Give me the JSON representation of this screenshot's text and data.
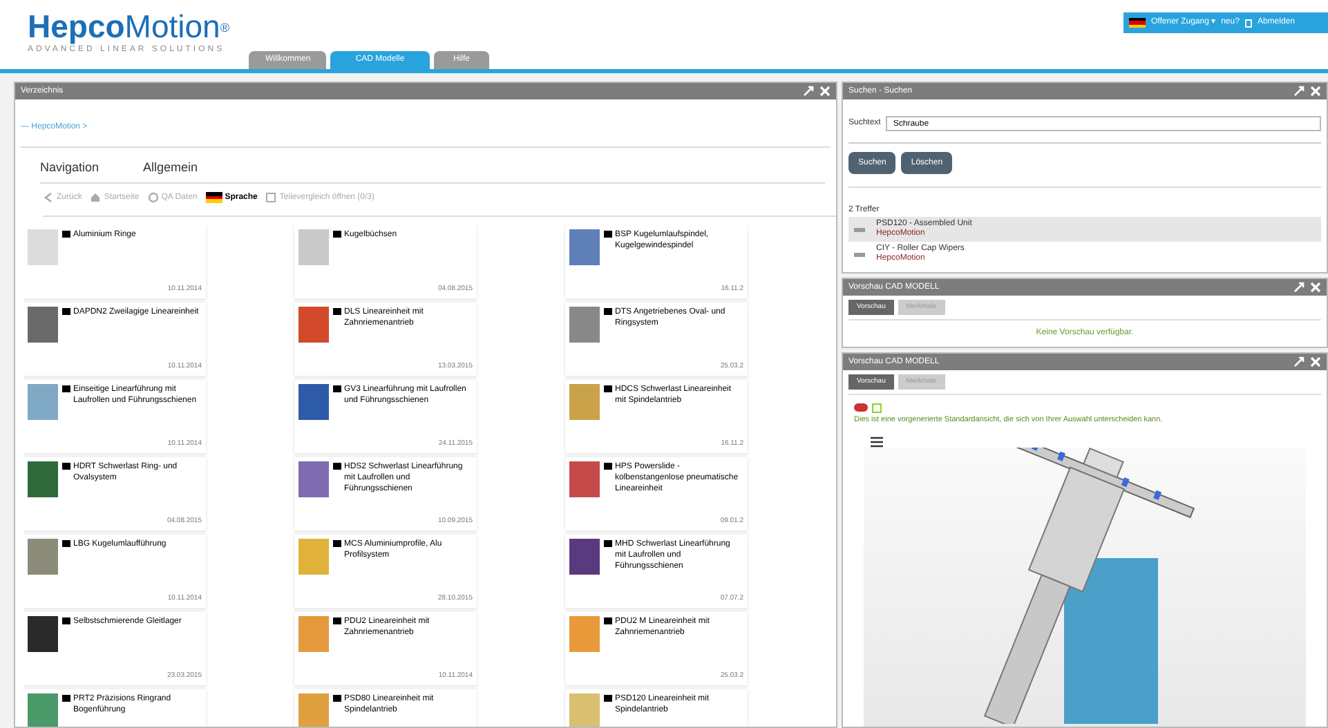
{
  "header": {
    "logo": {
      "name_bold": "Hepco",
      "name_light": "Motion",
      "mark": "®",
      "tagline": "ADVANCED LINEAR SOLUTIONS"
    },
    "tabs": [
      {
        "label": "Willkommen",
        "selected": false
      },
      {
        "label": "CAD Modelle",
        "selected": true
      },
      {
        "label": "Hilfe",
        "selected": false
      }
    ],
    "user_bar": {
      "access": "Offener Zugang",
      "caret": "▾",
      "links": [
        "neu?",
        "Abmelden"
      ]
    }
  },
  "catalog_panel": {
    "title": "Verzeichnis",
    "breadcrumb": "— HepcoMotion >",
    "nav_tabs": [
      "Navigation",
      "Allgemein"
    ],
    "toolbar": [
      {
        "kind": "back",
        "label": "Zurück"
      },
      {
        "kind": "home",
        "label": "Startseite"
      },
      {
        "kind": "qa",
        "label": "QA Daten"
      },
      {
        "kind": "language",
        "label": "Sprache"
      },
      {
        "kind": "compare",
        "label": "Teilevergleich öffnen (0/3)"
      }
    ],
    "items": [
      {
        "title": "Aluminium Ringe",
        "date": "10.11.2014"
      },
      {
        "title": "Kugelbüchsen",
        "date": "04.08.2015"
      },
      {
        "title": "BSP Kugelumlaufspindel, Kugelgewindespindel",
        "date": "16.11.2"
      },
      {
        "title": "DAPDN2 Zweilagige Lineareinheit",
        "date": "10.11.2014"
      },
      {
        "title": "DLS Lineareinheit mit Zahnriemenantrieb",
        "date": "13.03.2015"
      },
      {
        "title": "DTS Angetriebenes Oval- und Ringsystem",
        "date": "25.03.2"
      },
      {
        "title": "Einseitige Linearführung mit Laufrollen und Führungsschienen",
        "date": "10.11.2014"
      },
      {
        "title": "GV3 Linearführung mit Laufrollen und Führungsschienen",
        "date": "24.11.2015"
      },
      {
        "title": "HDCS Schwerlast Lineareinheit mit Spindelantrieb",
        "date": "16.11.2"
      },
      {
        "title": "HDRT Schwerlast Ring- und Ovalsystem",
        "date": "04.08.2015"
      },
      {
        "title": "HDS2 Schwerlast Linearführung mit Laufrollen und Führungsschienen",
        "date": "10.09.2015"
      },
      {
        "title": "HPS Powerslide - kolbenstangenlose pneumatische Lineareinheit",
        "date": "09.01.2"
      },
      {
        "title": "LBG Kugelumlaufführung",
        "date": "10.11.2014"
      },
      {
        "title": "MCS Aluminiumprofile, Alu Profilsystem",
        "date": "28.10.2015"
      },
      {
        "title": "MHD Schwerlast Linearführung mit Laufrollen und Führungsschienen",
        "date": "07.07.2"
      },
      {
        "title": "Selbstschmierende Gleitlager",
        "date": "23.03.2015"
      },
      {
        "title": "PDU2 Lineareinheit mit Zahnriemenantrieb",
        "date": "10.11.2014"
      },
      {
        "title": "PDU2 M Lineareinheit mit Zahnriemenantrieb",
        "date": "25.03.2"
      },
      {
        "title": "PRT2 Präzisions Ringrand Bogenführung"
      },
      {
        "title": "PSD80 Lineareinheit mit Spindelantrieb"
      },
      {
        "title": "PSD120 Lineareinheit mit Spindelantrieb"
      }
    ]
  },
  "search_panel": {
    "title": "Suchen - Suchen",
    "field_label": "Suchtext",
    "value": "Schraube",
    "buttons": [
      "Suchen",
      "Löschen"
    ],
    "count": "2 Treffer",
    "results": [
      {
        "title": "PSD120 - Assembled Unit",
        "source": "HepcoMotion",
        "selected": true
      },
      {
        "title": "CIY - Roller Cap Wipers",
        "source": "HepcoMotion",
        "selected": false
      }
    ]
  },
  "preview_panels": [
    {
      "title": "Vorschau CAD MODELL",
      "tabs": [
        {
          "label": "Vorschau",
          "selected": true
        },
        {
          "label": "Merkmale",
          "selected": false
        }
      ],
      "kind": "empty",
      "message": "Keine Vorschau verfügbar."
    },
    {
      "title": "Vorschau CAD MODELL",
      "tabs": [
        {
          "label": "Vorschau",
          "selected": true
        },
        {
          "label": "Merkmale",
          "selected": false
        }
      ],
      "kind": "viewer",
      "message": "Dies ist eine vorgenerierte Standardansicht, die sich von Ihrer Auswahl unterscheiden kann."
    }
  ]
}
